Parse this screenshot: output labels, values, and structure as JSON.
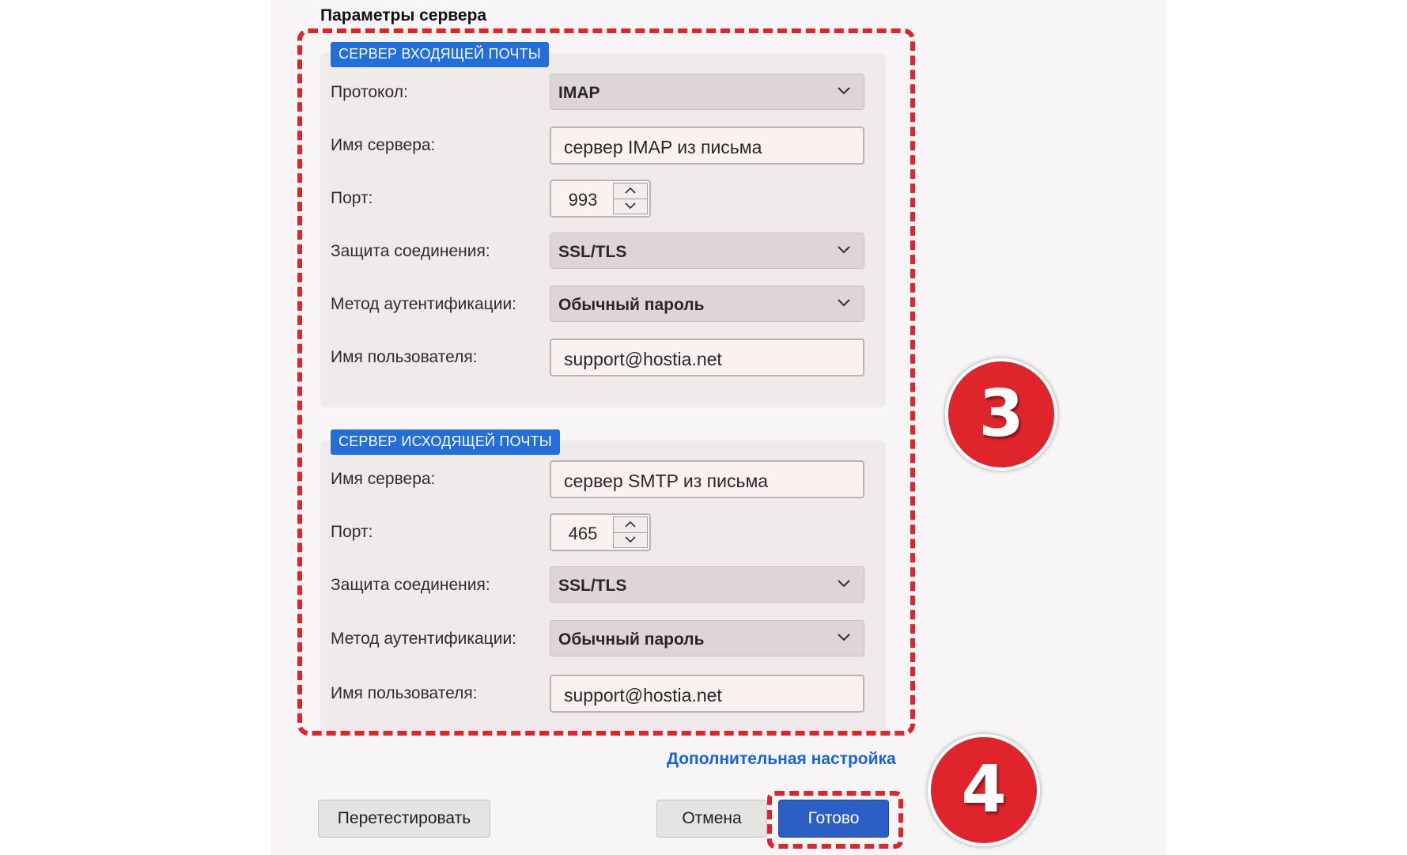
{
  "dialog": {
    "title": "Параметры сервера",
    "incoming": {
      "badge": "СЕРВЕР ВХОДЯЩЕЙ ПОЧТЫ",
      "protocol": {
        "label": "Протокол:",
        "value": "IMAP"
      },
      "server": {
        "label": "Имя сервера:",
        "value": "сервер IMAP из письма"
      },
      "port": {
        "label": "Порт:",
        "value": "993"
      },
      "security": {
        "label": "Защита соединения:",
        "value": "SSL/TLS"
      },
      "auth": {
        "label": "Метод аутентификации:",
        "value": "Обычный пароль"
      },
      "username": {
        "label": "Имя пользователя:",
        "value": "support@hostia.net"
      }
    },
    "outgoing": {
      "badge": "СЕРВЕР ИСХОДЯЩЕЙ ПОЧТЫ",
      "server": {
        "label": "Имя сервера:",
        "value": "сервер SMTP из письма"
      },
      "port": {
        "label": "Порт:",
        "value": "465"
      },
      "security": {
        "label": "Защита соединения:",
        "value": "SSL/TLS"
      },
      "auth": {
        "label": "Метод аутентификации:",
        "value": "Обычный пароль"
      },
      "username": {
        "label": "Имя пользователя:",
        "value": "support@hostia.net"
      }
    },
    "advanced_link": "Дополнительная настройка",
    "buttons": {
      "retest": "Перетестировать",
      "cancel": "Отмена",
      "done": "Готово"
    }
  },
  "annotations": {
    "step3": "3",
    "step4": "4"
  },
  "colors": {
    "accent": "#1565d8",
    "highlight": "#e0242c",
    "done_button": "#2b5fc5"
  },
  "icons": {
    "dropdown": "chevron-down-icon",
    "spin_up": "chevron-up-icon",
    "spin_down": "chevron-down-icon"
  }
}
